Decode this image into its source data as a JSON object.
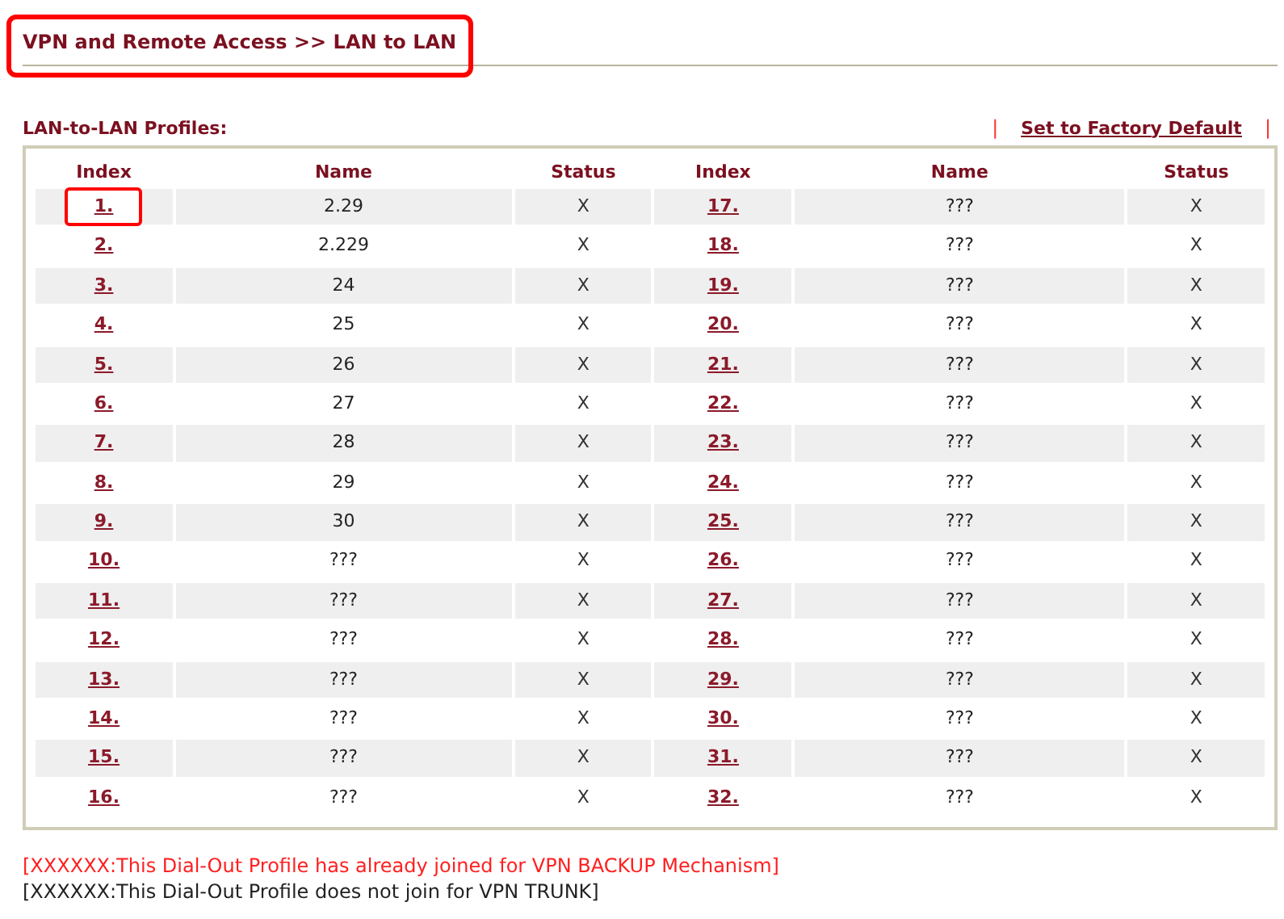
{
  "title": {
    "text": "VPN and Remote Access >> LAN to LAN",
    "highlighted": true
  },
  "section_title": "LAN-to-LAN Profiles:",
  "factory_default_link": "Set to Factory Default",
  "separator": "|",
  "table": {
    "columns": [
      "Index",
      "Name",
      "Status",
      "Index",
      "Name",
      "Status"
    ],
    "rows": [
      {
        "cells": [
          {
            "text": "1.",
            "kind": "index",
            "highlighted": true
          },
          {
            "text": "2.29",
            "kind": "name",
            "highlighted": false
          },
          {
            "text": "X",
            "kind": "status",
            "highlighted": false
          },
          {
            "text": "17.",
            "kind": "index",
            "highlighted": false
          },
          {
            "text": "???",
            "kind": "name",
            "highlighted": false
          },
          {
            "text": "X",
            "kind": "status",
            "highlighted": false
          }
        ]
      },
      {
        "cells": [
          {
            "text": "2.",
            "kind": "index",
            "highlighted": false
          },
          {
            "text": "2.229",
            "kind": "name",
            "highlighted": false
          },
          {
            "text": "X",
            "kind": "status",
            "highlighted": false
          },
          {
            "text": "18.",
            "kind": "index",
            "highlighted": false
          },
          {
            "text": "???",
            "kind": "name",
            "highlighted": false
          },
          {
            "text": "X",
            "kind": "status",
            "highlighted": false
          }
        ]
      },
      {
        "cells": [
          {
            "text": "3.",
            "kind": "index",
            "highlighted": false
          },
          {
            "text": "24",
            "kind": "name",
            "highlighted": false
          },
          {
            "text": "X",
            "kind": "status",
            "highlighted": false
          },
          {
            "text": "19.",
            "kind": "index",
            "highlighted": false
          },
          {
            "text": "???",
            "kind": "name",
            "highlighted": false
          },
          {
            "text": "X",
            "kind": "status",
            "highlighted": false
          }
        ]
      },
      {
        "cells": [
          {
            "text": "4.",
            "kind": "index",
            "highlighted": false
          },
          {
            "text": "25",
            "kind": "name",
            "highlighted": false
          },
          {
            "text": "X",
            "kind": "status",
            "highlighted": false
          },
          {
            "text": "20.",
            "kind": "index",
            "highlighted": false
          },
          {
            "text": "???",
            "kind": "name",
            "highlighted": false
          },
          {
            "text": "X",
            "kind": "status",
            "highlighted": false
          }
        ]
      },
      {
        "cells": [
          {
            "text": "5.",
            "kind": "index",
            "highlighted": false
          },
          {
            "text": "26",
            "kind": "name",
            "highlighted": false
          },
          {
            "text": "X",
            "kind": "status",
            "highlighted": false
          },
          {
            "text": "21.",
            "kind": "index",
            "highlighted": false
          },
          {
            "text": "???",
            "kind": "name",
            "highlighted": false
          },
          {
            "text": "X",
            "kind": "status",
            "highlighted": false
          }
        ]
      },
      {
        "cells": [
          {
            "text": "6.",
            "kind": "index",
            "highlighted": false
          },
          {
            "text": "27",
            "kind": "name",
            "highlighted": false
          },
          {
            "text": "X",
            "kind": "status",
            "highlighted": false
          },
          {
            "text": "22.",
            "kind": "index",
            "highlighted": false
          },
          {
            "text": "???",
            "kind": "name",
            "highlighted": false
          },
          {
            "text": "X",
            "kind": "status",
            "highlighted": false
          }
        ]
      },
      {
        "cells": [
          {
            "text": "7.",
            "kind": "index",
            "highlighted": false
          },
          {
            "text": "28",
            "kind": "name",
            "highlighted": false
          },
          {
            "text": "X",
            "kind": "status",
            "highlighted": false
          },
          {
            "text": "23.",
            "kind": "index",
            "highlighted": false
          },
          {
            "text": "???",
            "kind": "name",
            "highlighted": false
          },
          {
            "text": "X",
            "kind": "status",
            "highlighted": false
          }
        ]
      },
      {
        "cells": [
          {
            "text": "8.",
            "kind": "index",
            "highlighted": false
          },
          {
            "text": "29",
            "kind": "name",
            "highlighted": false
          },
          {
            "text": "X",
            "kind": "status",
            "highlighted": false
          },
          {
            "text": "24.",
            "kind": "index",
            "highlighted": false
          },
          {
            "text": "???",
            "kind": "name",
            "highlighted": false
          },
          {
            "text": "X",
            "kind": "status",
            "highlighted": false
          }
        ]
      },
      {
        "cells": [
          {
            "text": "9.",
            "kind": "index",
            "highlighted": false
          },
          {
            "text": "30",
            "kind": "name",
            "highlighted": false
          },
          {
            "text": "X",
            "kind": "status",
            "highlighted": false
          },
          {
            "text": "25.",
            "kind": "index",
            "highlighted": false
          },
          {
            "text": "???",
            "kind": "name",
            "highlighted": false
          },
          {
            "text": "X",
            "kind": "status",
            "highlighted": false
          }
        ]
      },
      {
        "cells": [
          {
            "text": "10.",
            "kind": "index",
            "highlighted": false
          },
          {
            "text": "???",
            "kind": "name",
            "highlighted": false
          },
          {
            "text": "X",
            "kind": "status",
            "highlighted": false
          },
          {
            "text": "26.",
            "kind": "index",
            "highlighted": false
          },
          {
            "text": "???",
            "kind": "name",
            "highlighted": false
          },
          {
            "text": "X",
            "kind": "status",
            "highlighted": false
          }
        ]
      },
      {
        "cells": [
          {
            "text": "11.",
            "kind": "index",
            "highlighted": false
          },
          {
            "text": "???",
            "kind": "name",
            "highlighted": false
          },
          {
            "text": "X",
            "kind": "status",
            "highlighted": false
          },
          {
            "text": "27.",
            "kind": "index",
            "highlighted": false
          },
          {
            "text": "???",
            "kind": "name",
            "highlighted": false
          },
          {
            "text": "X",
            "kind": "status",
            "highlighted": false
          }
        ]
      },
      {
        "cells": [
          {
            "text": "12.",
            "kind": "index",
            "highlighted": false
          },
          {
            "text": "???",
            "kind": "name",
            "highlighted": false
          },
          {
            "text": "X",
            "kind": "status",
            "highlighted": false
          },
          {
            "text": "28.",
            "kind": "index",
            "highlighted": false
          },
          {
            "text": "???",
            "kind": "name",
            "highlighted": false
          },
          {
            "text": "X",
            "kind": "status",
            "highlighted": false
          }
        ]
      },
      {
        "cells": [
          {
            "text": "13.",
            "kind": "index",
            "highlighted": false
          },
          {
            "text": "???",
            "kind": "name",
            "highlighted": false
          },
          {
            "text": "X",
            "kind": "status",
            "highlighted": false
          },
          {
            "text": "29.",
            "kind": "index",
            "highlighted": false
          },
          {
            "text": "???",
            "kind": "name",
            "highlighted": false
          },
          {
            "text": "X",
            "kind": "status",
            "highlighted": false
          }
        ]
      },
      {
        "cells": [
          {
            "text": "14.",
            "kind": "index",
            "highlighted": false
          },
          {
            "text": "???",
            "kind": "name",
            "highlighted": false
          },
          {
            "text": "X",
            "kind": "status",
            "highlighted": false
          },
          {
            "text": "30.",
            "kind": "index",
            "highlighted": false
          },
          {
            "text": "???",
            "kind": "name",
            "highlighted": false
          },
          {
            "text": "X",
            "kind": "status",
            "highlighted": false
          }
        ]
      },
      {
        "cells": [
          {
            "text": "15.",
            "kind": "index",
            "highlighted": false
          },
          {
            "text": "???",
            "kind": "name",
            "highlighted": false
          },
          {
            "text": "X",
            "kind": "status",
            "highlighted": false
          },
          {
            "text": "31.",
            "kind": "index",
            "highlighted": false
          },
          {
            "text": "???",
            "kind": "name",
            "highlighted": false
          },
          {
            "text": "X",
            "kind": "status",
            "highlighted": false
          }
        ]
      },
      {
        "cells": [
          {
            "text": "16.",
            "kind": "index",
            "highlighted": false
          },
          {
            "text": "???",
            "kind": "name",
            "highlighted": false
          },
          {
            "text": "X",
            "kind": "status",
            "highlighted": false
          },
          {
            "text": "32.",
            "kind": "index",
            "highlighted": false
          },
          {
            "text": "???",
            "kind": "name",
            "highlighted": false
          },
          {
            "text": "X",
            "kind": "status",
            "highlighted": false
          }
        ]
      }
    ]
  },
  "notes": [
    {
      "text": "[XXXXXX:This Dial-Out Profile has already joined for VPN BACKUP Mechanism]",
      "kind": "backup"
    },
    {
      "text": "[XXXXXX:This Dial-Out Profile does not join for VPN TRUNK]",
      "kind": "trunk"
    }
  ]
}
